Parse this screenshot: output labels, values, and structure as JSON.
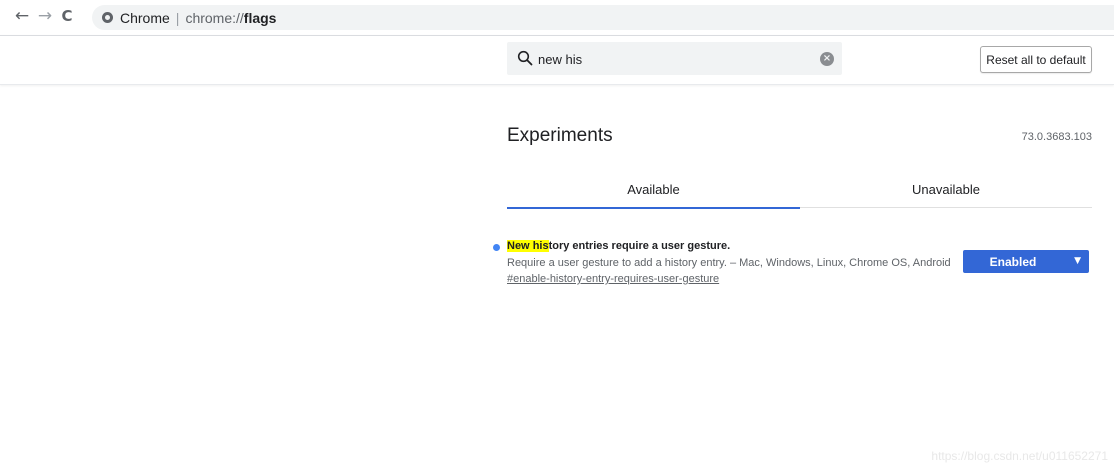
{
  "browser": {
    "back_glyph": "←",
    "forward_glyph": "→",
    "reload_glyph": "C",
    "omnibox": {
      "icon": "chrome-icon",
      "site": "Chrome",
      "separator": "|",
      "scheme": "chrome://",
      "path": "flags"
    }
  },
  "header": {
    "search": {
      "value": "new his",
      "icon": "search-icon",
      "clear_glyph": "×"
    },
    "reset_label": "Reset all to default"
  },
  "main": {
    "title": "Experiments",
    "version": "73.0.3683.103",
    "tabs": [
      {
        "label": "Available"
      },
      {
        "label": "Unavailable"
      }
    ],
    "experiments": [
      {
        "title_highlight_1": "New ",
        "title_highlight_2": "his",
        "title_rest": "tory entries require a user gesture.",
        "description": "Require a user gesture to add a history entry. – Mac, Windows, Linux, Chrome OS, Android",
        "link": "#enable-history-entry-requires-user-gesture",
        "select_value": "Enabled",
        "select_glyph": "▼"
      }
    ]
  },
  "watermark": "https://blog.csdn.net/u011652271",
  "colors": {
    "accent": "#3367d6",
    "dot": "#4285f4",
    "highlight": "#ffff00"
  }
}
